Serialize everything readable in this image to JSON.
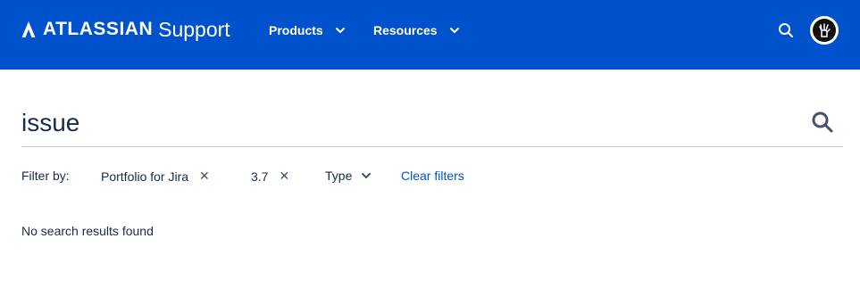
{
  "header": {
    "brand": "ATLASSIAN",
    "product": "Support",
    "nav": [
      {
        "label": "Products"
      },
      {
        "label": "Resources"
      }
    ],
    "colors": {
      "background": "#0052cc",
      "text": "#ffffff"
    }
  },
  "search": {
    "value": "issue"
  },
  "filters": {
    "label": "Filter by:",
    "chips": [
      {
        "label": "Portfolio for Jira",
        "removable": true
      },
      {
        "label": "3.7",
        "removable": true
      }
    ],
    "type_dropdown": {
      "label": "Type"
    },
    "clear_label": "Clear filters",
    "remove_glyph": "✕"
  },
  "results": {
    "message": "No search results found"
  },
  "icons": {
    "logo": "atlassian-logo-icon",
    "nav_chevron": "chevron-down-icon",
    "header_search": "search-icon",
    "avatar": "user-avatar-icon",
    "search_submit": "search-icon",
    "chip_remove": "close-icon"
  },
  "colors": {
    "link": "#0052cc",
    "text": "#172b4d",
    "divider": "#c1c7d0"
  }
}
